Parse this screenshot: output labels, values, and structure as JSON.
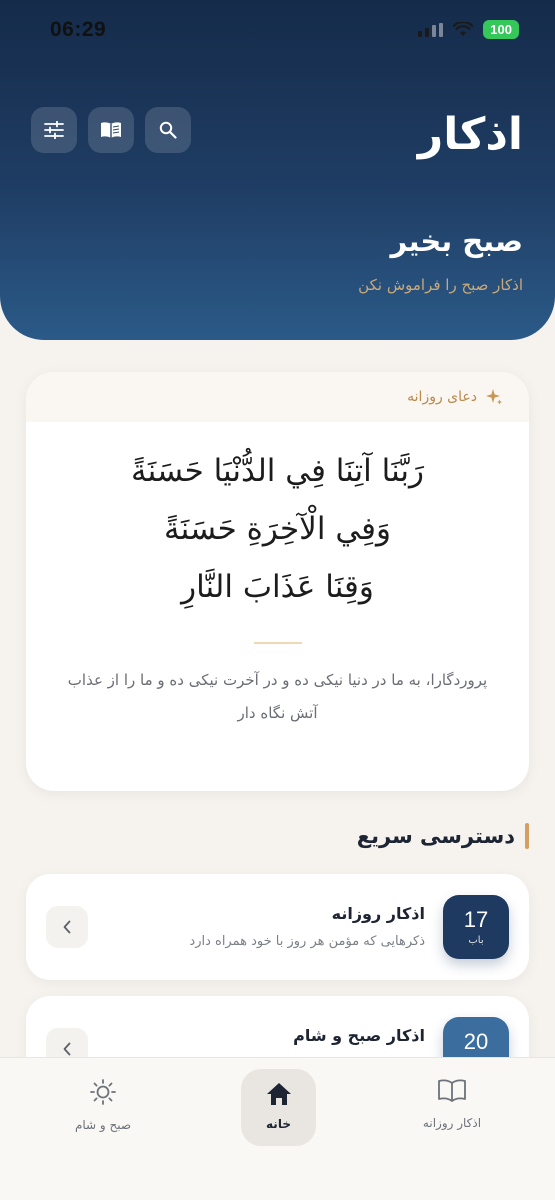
{
  "status": {
    "time": "06:29",
    "battery": "100"
  },
  "header": {
    "logo": "اذکار",
    "greeting": "صبح بخیر",
    "subtitle": "اذکار صبح را فراموش نکن",
    "icons": [
      "filter-icon",
      "book-icon",
      "search-icon"
    ]
  },
  "daily_dua": {
    "label": "دعای روزانه",
    "arabic_lines": [
      "رَبَّنَا آتِنَا فِي الدُّنْيَا حَسَنَةً",
      "وَفِي الْآخِرَةِ حَسَنَةً",
      "وَقِنَا عَذَابَ النَّارِ"
    ],
    "translation_lines": [
      "پروردگارا، به ما در دنیا نیکی ده و در آخرت نیکی ده و ما را از عذاب",
      "آتش نگاه دار"
    ]
  },
  "quick_access": {
    "title": "دسترسی سریع",
    "items": [
      {
        "count": "17",
        "unit": "باب",
        "title": "اذکار روزانه",
        "desc": "ذکرهایی که مؤمن هر روز با خود همراه دارد",
        "badge_color": "#1f3a61"
      },
      {
        "count": "20",
        "unit": "",
        "title": "اذکار صبح و شام",
        "desc": "",
        "badge_color": "#3c6d9f"
      }
    ]
  },
  "bottom_nav": {
    "items": [
      {
        "label": "صبح و شام",
        "icon": "sun-icon"
      },
      {
        "label": "خانه",
        "icon": "home-icon"
      },
      {
        "label": "اذکار روزانه",
        "icon": "open-book-icon"
      }
    ]
  },
  "colors": {
    "accent": "#d4a062",
    "primary": "#1f3d64",
    "background": "#f6f3ee"
  }
}
